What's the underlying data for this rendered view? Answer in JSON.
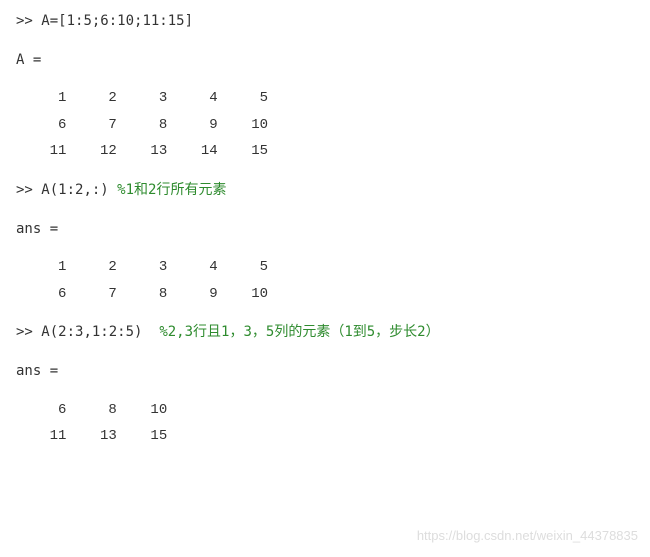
{
  "lines": {
    "cmd1_prompt": ">> ",
    "cmd1_code": "A=[1:5;6:10;11:15]",
    "out1_label": "A =",
    "matrix1": [
      "     1     2     3     4     5",
      "     6     7     8     9    10",
      "    11    12    13    14    15"
    ],
    "cmd2_prompt": ">> ",
    "cmd2_code": "A(1:2,:) ",
    "cmd2_comment": "%1和2行所有元素",
    "out2_label": "ans =",
    "matrix2": [
      "     1     2     3     4     5",
      "     6     7     8     9    10"
    ],
    "cmd3_prompt": ">> ",
    "cmd3_code": "A(2:3,1:2:5)  ",
    "cmd3_comment": "%2,3行且1，3，5列的元素（1到5，步长2）",
    "out3_label": "ans =",
    "matrix3": [
      "     6     8    10",
      "    11    13    15"
    ]
  },
  "watermark": "https://blog.csdn.net/weixin_44378835"
}
